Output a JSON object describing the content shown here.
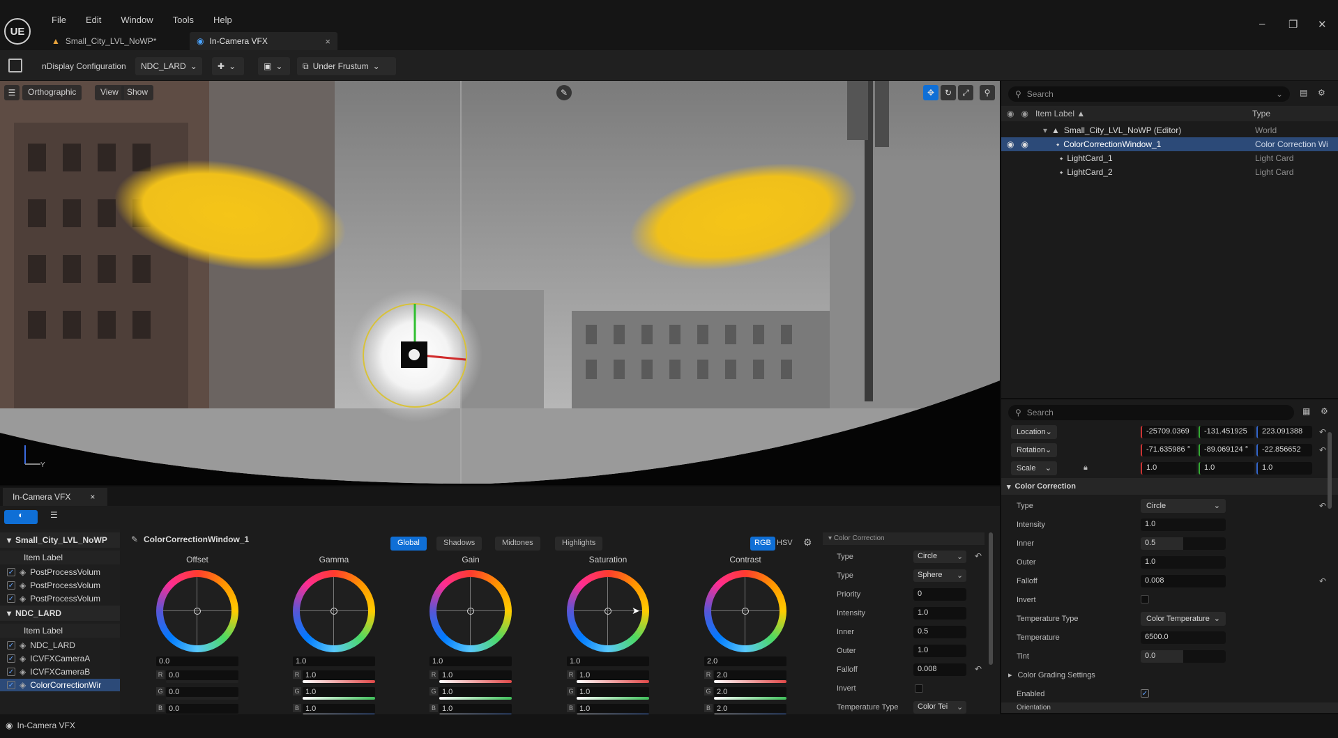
{
  "menu": [
    "File",
    "Edit",
    "Window",
    "Tools",
    "Help"
  ],
  "logo": "UE",
  "tabs": [
    {
      "label": "Small_City_LVL_NoWP*"
    },
    {
      "label": "In-Camera VFX",
      "close": "×"
    }
  ],
  "window_controls": {
    "minimize": "–",
    "restore": "❐",
    "close": "✕"
  },
  "toolbar": {
    "config_label": "nDisplay Configuration",
    "config_value": "NDC_LARD",
    "frustum_value": "Under Frustum"
  },
  "viewport": {
    "buttons": [
      "Orthographic",
      "View",
      "Show"
    ],
    "axis_label": "Y"
  },
  "outliner": {
    "search_placeholder": "Search",
    "col_label": "Item Label ▲",
    "col_type": "Type",
    "rows": [
      {
        "label": "Small_City_LVL_NoWP (Editor)",
        "type": "World"
      },
      {
        "label": "ColorCorrectionWindow_1",
        "type": "Color Correction Wi"
      },
      {
        "label": "LightCard_1",
        "type": "Light Card"
      },
      {
        "label": "LightCard_2",
        "type": "Light Card"
      }
    ]
  },
  "details": {
    "search_placeholder": "Search",
    "location": {
      "label": "Location",
      "x": "-25709.0369",
      "y": "-131.451925",
      "z": "223.091388"
    },
    "rotation": {
      "label": "Rotation",
      "x": "-71.635986 °",
      "y": "-89.069124 °",
      "z": "-22.856652"
    },
    "scale": {
      "label": "Scale",
      "x": "1.0",
      "y": "1.0",
      "z": "1.0"
    },
    "section_cc": "Color Correction",
    "props": [
      {
        "label": "Type",
        "value": "Circle",
        "kind": "dropdown"
      },
      {
        "label": "Intensity",
        "value": "1.0",
        "kind": "slider",
        "fill": 0.0
      },
      {
        "label": "Inner",
        "value": "0.5",
        "kind": "slider",
        "fill": 0.5
      },
      {
        "label": "Outer",
        "value": "1.0",
        "kind": "slider",
        "fill": 0.0
      },
      {
        "label": "Falloff",
        "value": "0.008",
        "kind": "field"
      },
      {
        "label": "Invert",
        "value": "",
        "kind": "checkbox"
      },
      {
        "label": "Temperature Type",
        "value": "Color Temperature",
        "kind": "dropdown"
      },
      {
        "label": "Temperature",
        "value": "6500.0",
        "kind": "slider",
        "fill": 0.0
      },
      {
        "label": "Tint",
        "value": "0.0",
        "kind": "slider",
        "fill": 0.5
      }
    ],
    "section_cgs": "Color Grading Settings",
    "enabled_label": "Enabled",
    "cut_label": "Orientation"
  },
  "icvfx": {
    "tab_label": "In-Camera VFX",
    "tab_close": "×",
    "list": [
      {
        "kind": "hdr",
        "label": "Small_City_LVL_NoWP"
      },
      {
        "kind": "sub",
        "label": "Item Label"
      },
      {
        "kind": "item",
        "label": "PostProcessVolum"
      },
      {
        "kind": "item",
        "label": "PostProcessVolum"
      },
      {
        "kind": "item",
        "label": "PostProcessVolum"
      },
      {
        "kind": "hdr",
        "label": "NDC_LARD"
      },
      {
        "kind": "sub",
        "label": "Item Label"
      },
      {
        "kind": "item",
        "label": "NDC_LARD"
      },
      {
        "kind": "item",
        "label": "ICVFXCameraA"
      },
      {
        "kind": "item",
        "label": "ICVFXCameraB"
      },
      {
        "kind": "item",
        "label": "ColorCorrectionWir"
      }
    ],
    "object_title": "ColorCorrectionWindow_1",
    "range_tabs": [
      "Global",
      "Shadows",
      "Midtones",
      "Highlights"
    ],
    "color_mode": [
      "RGB",
      "HSV"
    ],
    "wheels": [
      {
        "title": "Offset",
        "main": "0.0",
        "r": "0.0",
        "g": "0.0",
        "b": "0.0"
      },
      {
        "title": "Gamma",
        "main": "1.0",
        "r": "1.0",
        "g": "1.0",
        "b": "1.0"
      },
      {
        "title": "Gain",
        "main": "1.0",
        "r": "1.0",
        "g": "1.0",
        "b": "1.0"
      },
      {
        "title": "Saturation",
        "main": "1.0",
        "r": "1.0",
        "g": "1.0",
        "b": "1.0"
      },
      {
        "title": "Contrast",
        "main": "2.0",
        "r": "2.0",
        "g": "2.0",
        "b": "2.0"
      }
    ],
    "channels": [
      "R",
      "G",
      "B"
    ],
    "props_section": "Color Correction",
    "props": [
      {
        "label": "Type",
        "value": "Circle"
      },
      {
        "label": "Type",
        "value": "Sphere"
      },
      {
        "label": "Priority",
        "value": "0"
      },
      {
        "label": "Intensity",
        "value": "1.0"
      },
      {
        "label": "Inner",
        "value": "0.5"
      },
      {
        "label": "Outer",
        "value": "1.0"
      },
      {
        "label": "Falloff",
        "value": "0.008"
      },
      {
        "label": "Invert",
        "value": ""
      },
      {
        "label": "Temperature Type",
        "value": "Color Tei"
      }
    ]
  },
  "statusbar": {
    "label": "In-Camera VFX"
  },
  "colors": {
    "accent": "#0f6fd6",
    "lightcard": "#f2c21b",
    "selection": "#2c4a78"
  }
}
